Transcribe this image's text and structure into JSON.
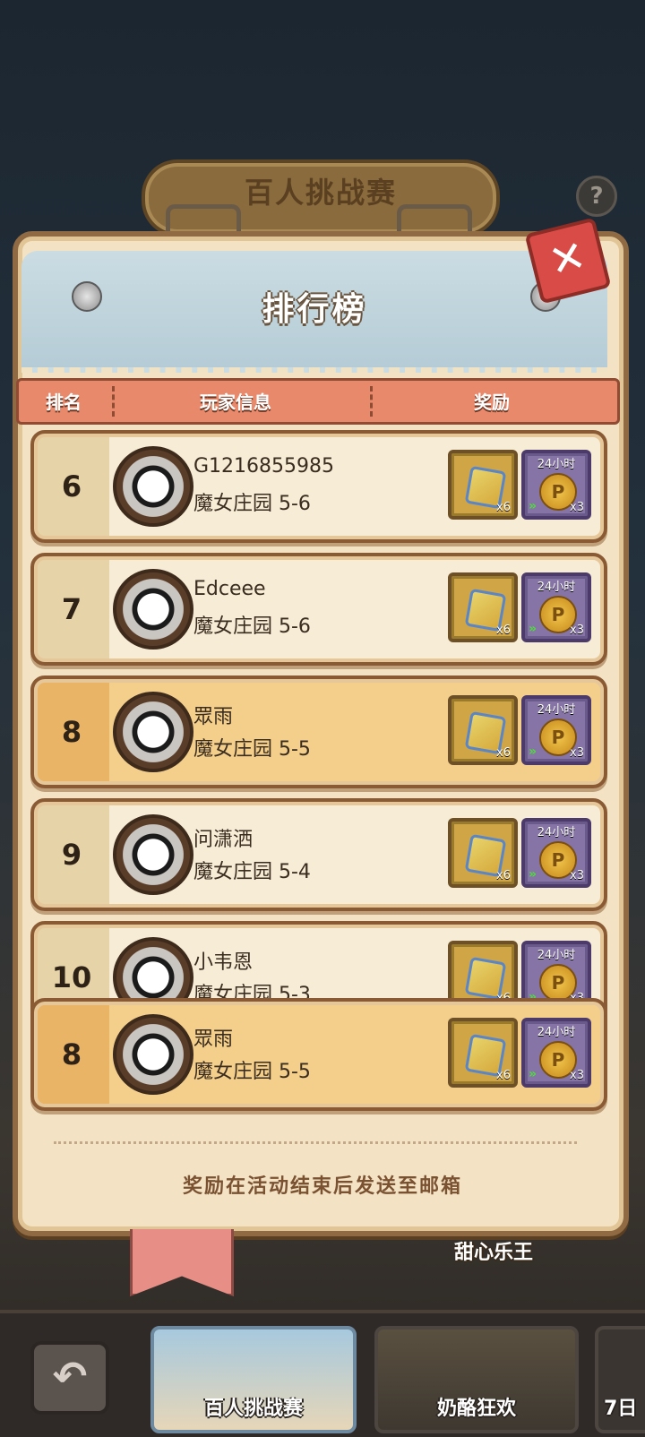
{
  "background": {
    "event_title": "百人挑战赛",
    "help_symbol": "?",
    "subtitle": "甜心乐王"
  },
  "panel": {
    "title": "排行榜",
    "close_symbol": "✕",
    "columns": {
      "rank": "排名",
      "player": "玩家信息",
      "reward": "奖励"
    }
  },
  "rows": [
    {
      "rank": "6",
      "name": "G1216855985",
      "stage": "魔女庄园 5-6",
      "box_qty": "x6",
      "coin_tag": "24小时",
      "coin_qty": "x3"
    },
    {
      "rank": "7",
      "name": "Edceee",
      "stage": "魔女庄园 5-6",
      "box_qty": "x6",
      "coin_tag": "24小时",
      "coin_qty": "x3"
    },
    {
      "rank": "8",
      "name": "眾雨",
      "stage": "魔女庄园 5-5",
      "box_qty": "x6",
      "coin_tag": "24小时",
      "coin_qty": "x3"
    },
    {
      "rank": "9",
      "name": "问潇洒",
      "stage": "魔女庄园 5-4",
      "box_qty": "x6",
      "coin_tag": "24小时",
      "coin_qty": "x3"
    },
    {
      "rank": "10",
      "name": "小韦恩",
      "stage": "魔女庄园 5-3",
      "box_qty": "x6",
      "coin_tag": "24小时",
      "coin_qty": "x3"
    }
  ],
  "self_row": {
    "rank": "8",
    "name": "眾雨",
    "stage": "魔女庄园 5-5",
    "box_qty": "x6",
    "coin_tag": "24小时",
    "coin_qty": "x3"
  },
  "footer": {
    "note": "奖励在活动结束后发送至邮箱"
  },
  "bottom_nav": {
    "back_symbol": "↶",
    "tabs": [
      {
        "label": "百人挑战赛"
      },
      {
        "label": "奶酪狂欢"
      },
      {
        "label": "7日"
      }
    ]
  },
  "icons": {
    "box_reward": "cube-box-icon",
    "coin_reward": "gold-coin-icon",
    "avatar": "character-avatar-icon"
  }
}
